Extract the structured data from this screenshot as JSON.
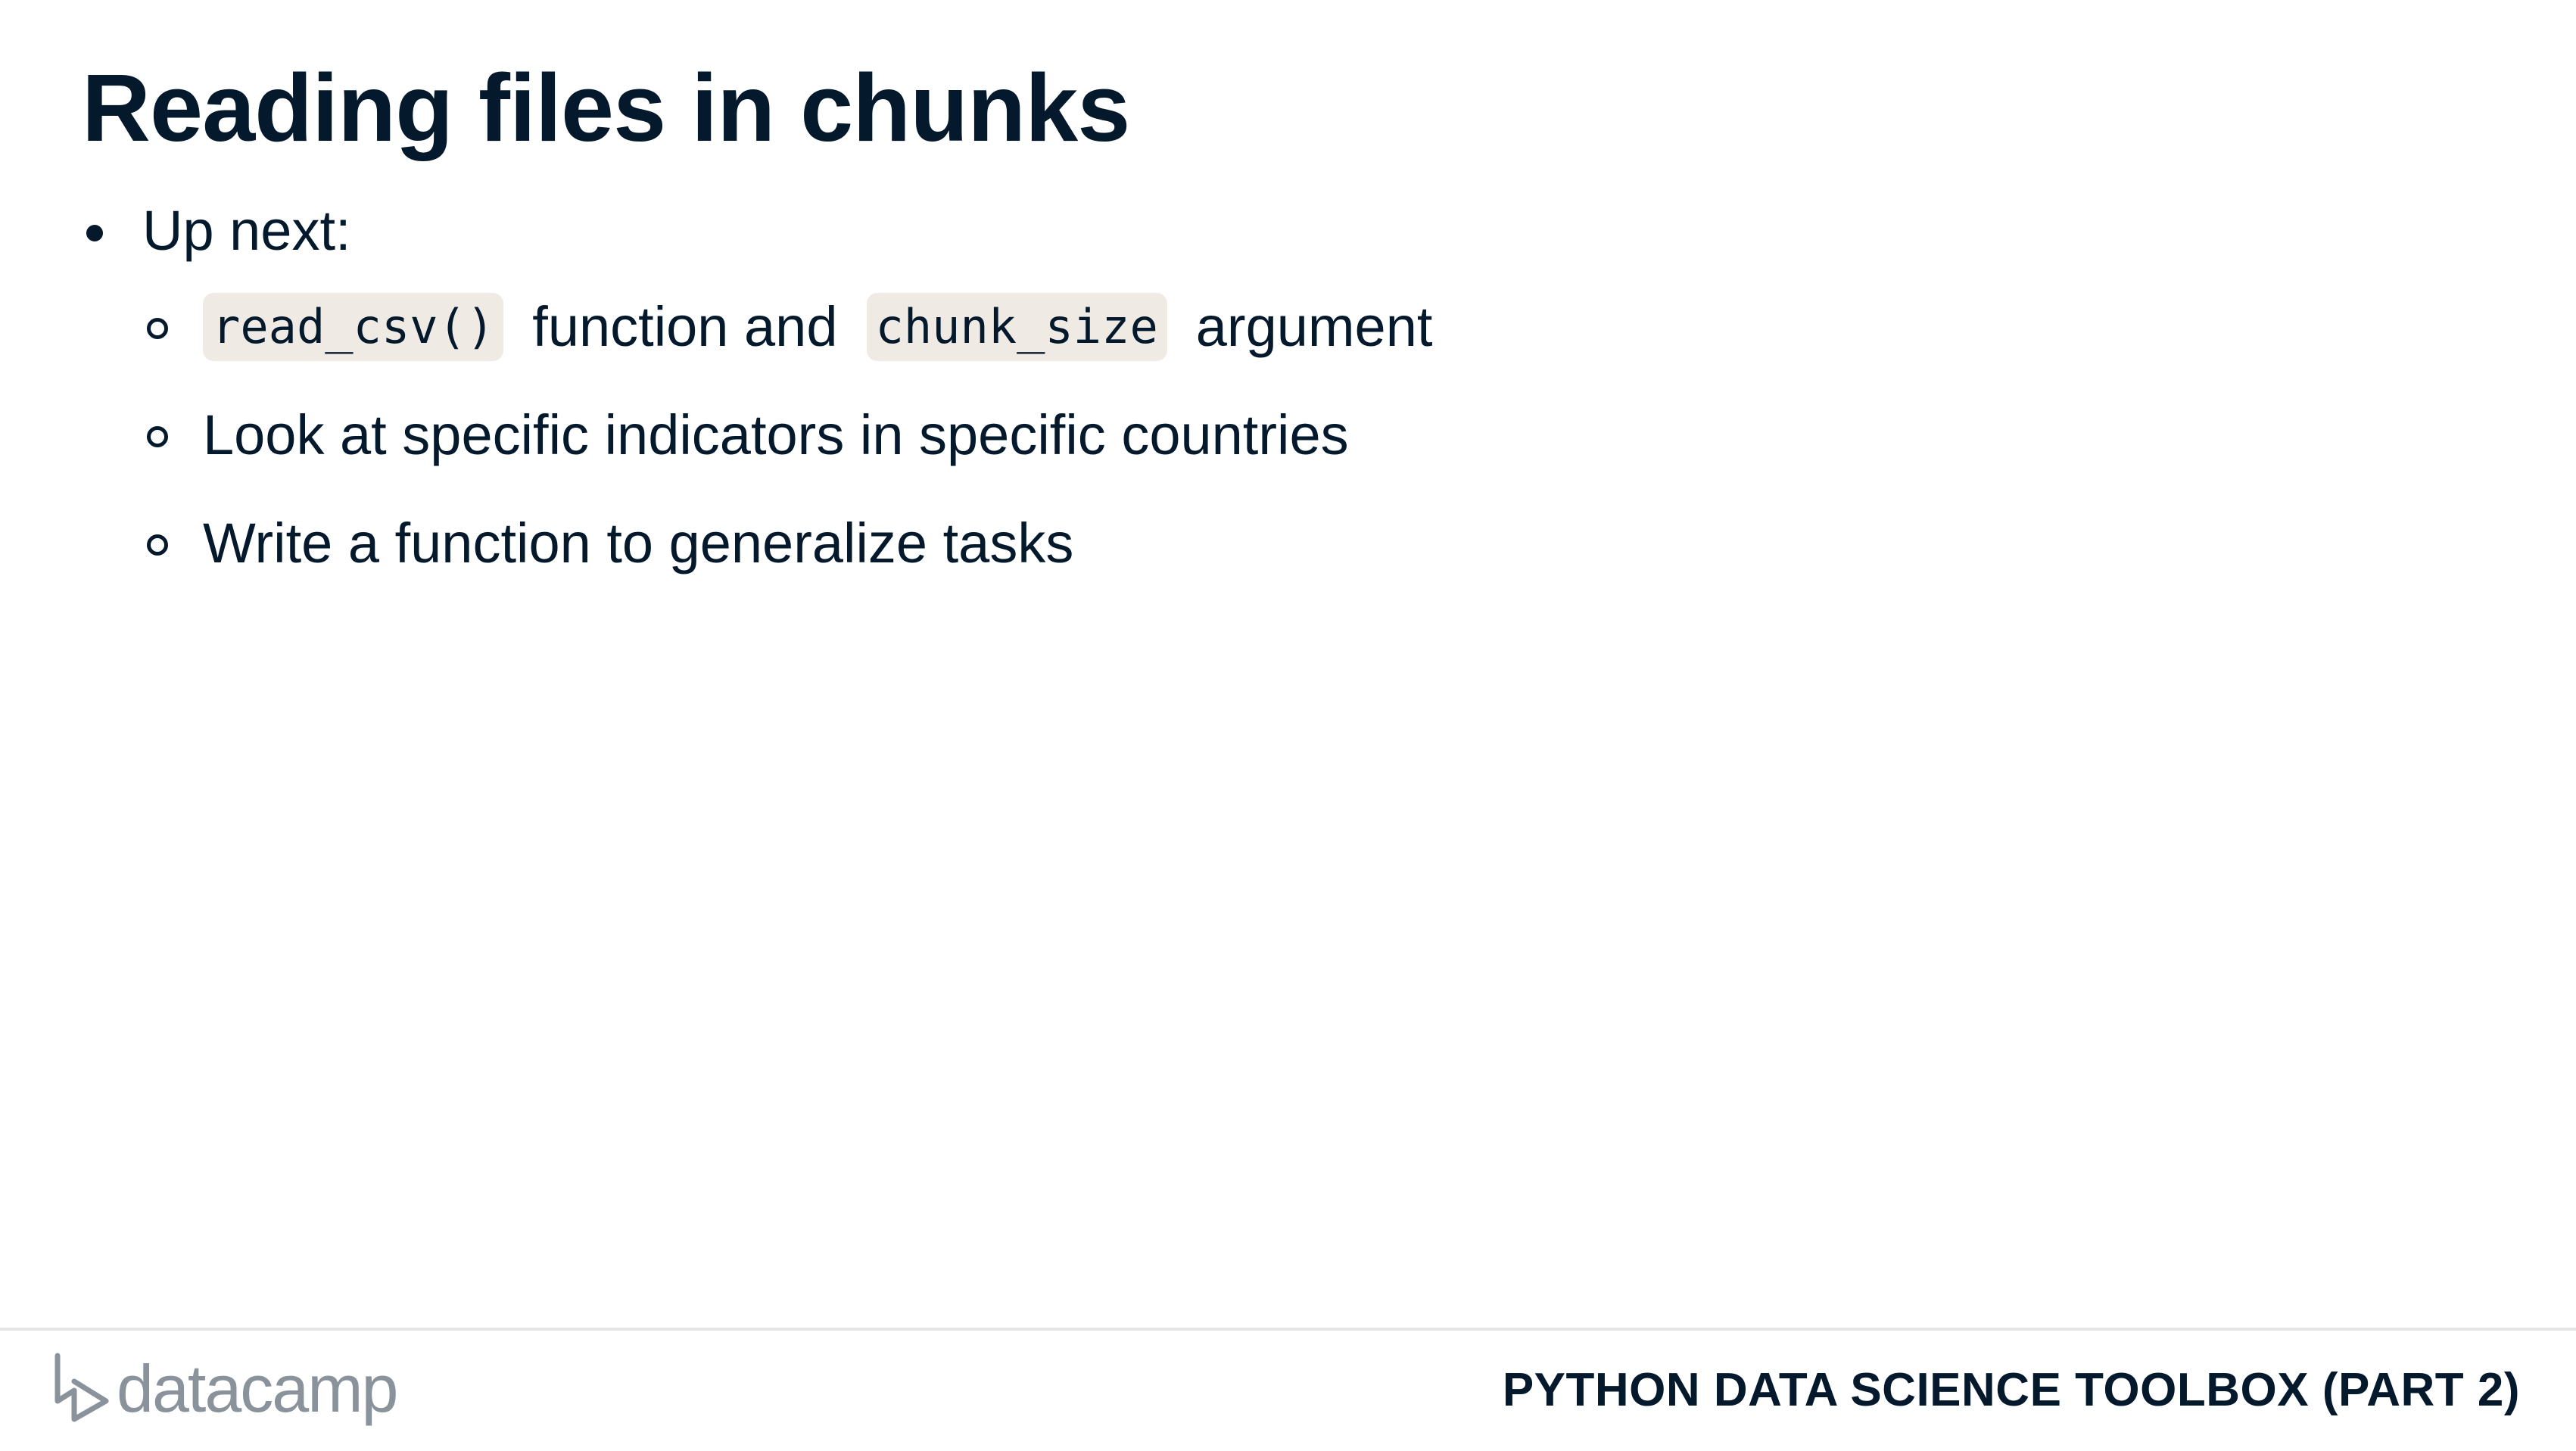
{
  "slide": {
    "title": "Reading files in chunks",
    "bullets": [
      {
        "text": "Up next:",
        "sub": [
          {
            "parts": [
              {
                "type": "code",
                "text": "read_csv()"
              },
              {
                "type": "text",
                "text": "function and"
              },
              {
                "type": "code",
                "text": "chunk_size"
              },
              {
                "type": "text",
                "text": "argument"
              }
            ]
          },
          {
            "text": "Look at specific indicators in specific countries"
          },
          {
            "text": "Write a function to generalize tasks"
          }
        ]
      }
    ]
  },
  "footer": {
    "logo_text": "datacamp",
    "course_title": "PYTHON DATA SCIENCE TOOLBOX (PART 2)"
  },
  "colors": {
    "text": "#05192d",
    "code_bg": "#efebe4",
    "logo": "#8a929b",
    "rule": "#e5e5e5"
  }
}
